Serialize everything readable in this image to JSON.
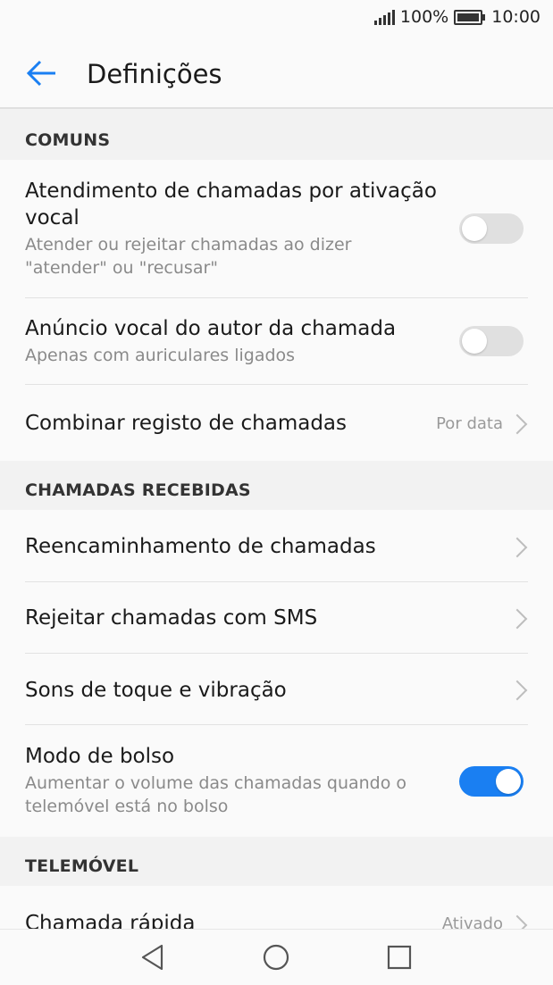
{
  "status_bar": {
    "battery_percent": "100%",
    "time": "10:00",
    "icons": [
      "signal-icon",
      "battery-icon"
    ]
  },
  "app_bar": {
    "title": "Definições",
    "back_icon": "arrow-left-icon"
  },
  "accent_color": "#1a7ff2",
  "sections": [
    {
      "header": "COMUNS"
    },
    {
      "header": "CHAMADAS RECEBIDAS"
    },
    {
      "header": "TELEMÓVEL"
    }
  ],
  "comuns": {
    "voice_answer": {
      "label": "Atendimento de chamadas por ativação vocal",
      "sub": "Atender ou rejeitar chamadas ao dizer \"atender\" ou \"recusar\"",
      "enabled": false
    },
    "caller_announce": {
      "label": "Anúncio vocal do autor da chamada",
      "sub": "Apenas com auriculares ligados",
      "enabled": false
    },
    "merge_log": {
      "label": "Combinar registo de chamadas",
      "value": "Por data"
    }
  },
  "recebidas": {
    "forwarding": {
      "label": "Reencaminhamento de chamadas"
    },
    "reject_sms": {
      "label": "Rejeitar chamadas com SMS"
    },
    "ringtones": {
      "label": "Sons de toque e vibração"
    },
    "pocket_mode": {
      "label": "Modo de bolso",
      "sub": "Aumentar o volume das chamadas quando o telemóvel está no bolso",
      "enabled": true
    }
  },
  "telemovel": {
    "speed_dial": {
      "label": "Chamada rápida",
      "value": "Ativado"
    }
  },
  "nav_bar": {
    "icons": [
      "back-triangle-icon",
      "home-circle-icon",
      "recents-square-icon"
    ]
  }
}
